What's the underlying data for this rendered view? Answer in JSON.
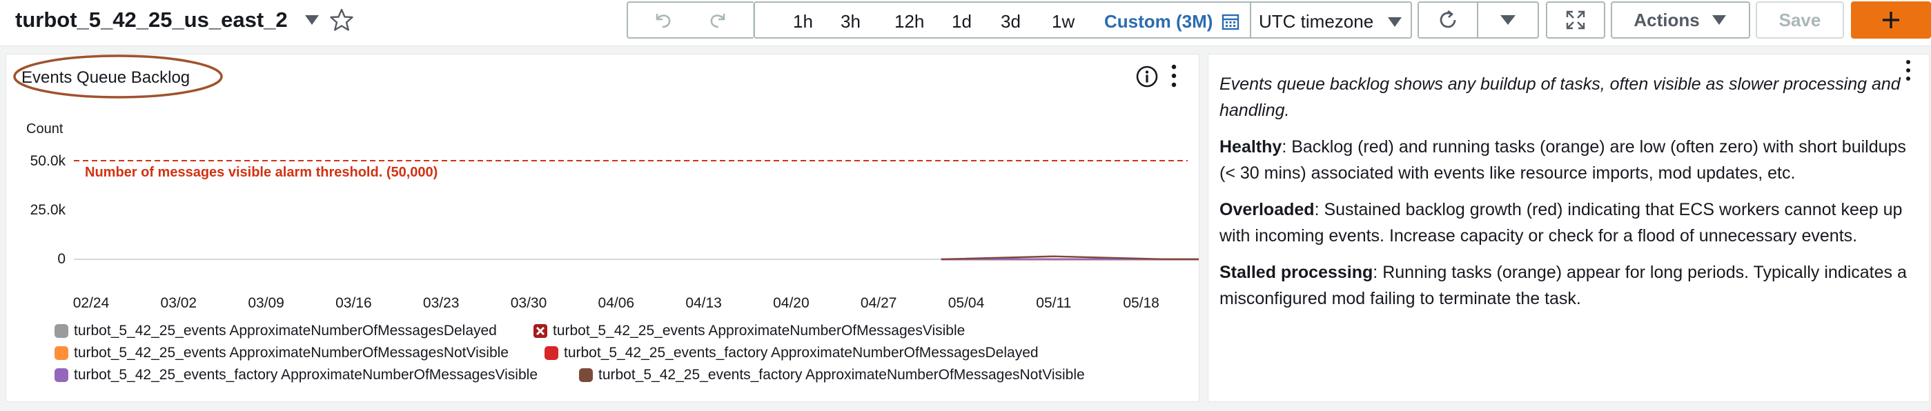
{
  "dashboard": {
    "title": "turbot_5_42_25_us_east_2"
  },
  "toolbar": {
    "time_ranges": [
      "1h",
      "3h",
      "12h",
      "1d",
      "3d",
      "1w"
    ],
    "custom_range": "Custom (3M)",
    "timezone": "UTC timezone",
    "actions_label": "Actions",
    "save_label": "Save"
  },
  "icons": {
    "undo": "undo-icon",
    "redo": "redo-icon",
    "calendar": "calendar-icon",
    "refresh": "refresh-icon",
    "expand": "fullscreen-icon",
    "add": "plus-icon",
    "info": "info-icon",
    "more": "kebab-icon",
    "star": "star-icon"
  },
  "colors": {
    "accent_orange": "#ec7211",
    "threshold_red": "#d13212",
    "custom_blue": "#2b6cb0"
  },
  "widget": {
    "title": "Events Queue Backlog"
  },
  "chart_data": {
    "type": "line",
    "ylabel": "Count",
    "yticks": [
      "50.0k",
      "25.0k",
      "0"
    ],
    "ylim": [
      0,
      50000
    ],
    "x": [
      "02/24",
      "03/02",
      "03/09",
      "03/16",
      "03/23",
      "03/30",
      "04/06",
      "04/13",
      "04/20",
      "04/27",
      "05/04",
      "05/11",
      "05/18"
    ],
    "annotation": {
      "label": "Number of messages visible alarm threshold. (50,000)",
      "value": 50000
    },
    "series": [
      {
        "name": "turbot_5_42_25_events ApproximateNumberOfMessagesDelayed",
        "color": "#9b9b9b",
        "marker": "square",
        "start": "05/02",
        "values": [
          0,
          0,
          0,
          0
        ]
      },
      {
        "name": "turbot_5_42_25_events ApproximateNumberOfMessagesVisible",
        "color": "#a51c1c",
        "marker": "x",
        "start": "05/02",
        "values": [
          0,
          0,
          0,
          0
        ]
      },
      {
        "name": "turbot_5_42_25_events ApproximateNumberOfMessagesNotVisible",
        "color": "#ff8f3a",
        "marker": "square",
        "start": "05/02",
        "values": [
          0,
          0,
          0,
          0
        ]
      },
      {
        "name": "turbot_5_42_25_events_factory ApproximateNumberOfMessagesDelayed",
        "color": "#d62728",
        "marker": "square",
        "start": "05/02",
        "values": [
          0,
          0,
          0,
          0
        ]
      },
      {
        "name": "turbot_5_42_25_events_factory ApproximateNumberOfMessagesVisible",
        "color": "#9467bd",
        "marker": "square",
        "start": "05/02",
        "values": [
          0,
          0,
          0,
          0
        ]
      },
      {
        "name": "turbot_5_42_25_events_factory ApproximateNumberOfMessagesNotVisible",
        "color": "#7b4b3a",
        "marker": "square",
        "start": "05/02",
        "values": [
          0,
          1500,
          0,
          0
        ]
      }
    ],
    "grid": false,
    "legend": "bottom"
  },
  "description": {
    "intro": "Events queue backlog shows any buildup of tasks, often visible as slower processing and handling.",
    "sections": [
      {
        "heading": "Healthy",
        "text": ": Backlog (red) and running tasks (orange) are low (often zero) with short buildups (< 30 mins) associated with events like resource imports, mod updates, etc."
      },
      {
        "heading": "Overloaded",
        "text": ": Sustained backlog growth (red) indicating that ECS workers cannot keep up with incoming events. Increase capacity or check for a flood of unnecessary events."
      },
      {
        "heading": "Stalled processing",
        "text": ": Running tasks (orange) appear for long periods. Typically indicates a misconfigured mod failing to terminate the task."
      }
    ]
  }
}
